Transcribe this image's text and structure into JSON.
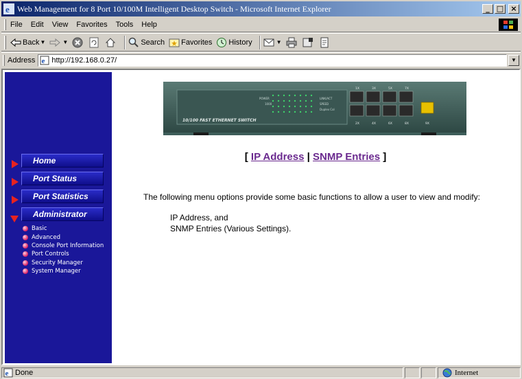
{
  "window": {
    "title": "Web Management for 8 Port 10/100M Intelligent Desktop Switch - Microsoft Internet Explorer",
    "minimize": "_",
    "maximize": "□",
    "close": "×"
  },
  "menubar": {
    "items": [
      {
        "label": "File"
      },
      {
        "label": "Edit"
      },
      {
        "label": "View"
      },
      {
        "label": "Favorites"
      },
      {
        "label": "Tools"
      },
      {
        "label": "Help"
      }
    ]
  },
  "toolbar": {
    "back": "Back",
    "search": "Search",
    "favorites": "Favorites",
    "history": "History"
  },
  "address": {
    "label": "Address",
    "url": "http://192.168.0.27/"
  },
  "sidebar": {
    "nav": [
      {
        "label": "Home",
        "expanded": false
      },
      {
        "label": "Port Status",
        "expanded": false
      },
      {
        "label": "Port Statistics",
        "expanded": false
      },
      {
        "label": "Administrator",
        "expanded": true
      }
    ],
    "sub_items": [
      {
        "label": "Basic"
      },
      {
        "label": "Advanced"
      },
      {
        "label": "Console Port Information"
      },
      {
        "label": "Port Controls"
      },
      {
        "label": "Security Manager"
      },
      {
        "label": "System Manager"
      }
    ]
  },
  "device": {
    "label": "10/100 FAST ETHERNET SWITCH",
    "indicators": [
      "POWER",
      "1000",
      "LINK/ACT",
      "SPEED",
      "Duplex Col"
    ],
    "port_labels_top": [
      "1X",
      "3X",
      "5X",
      "7X"
    ],
    "port_labels_bottom": [
      "2X",
      "4X",
      "6X",
      "8X",
      "9X"
    ]
  },
  "main": {
    "bracket_open": "[",
    "bracket_close": "]",
    "separator": "|",
    "link_ip": "IP Address",
    "link_snmp": "SNMP Entries",
    "description": "The following menu options provide some basic functions to allow a user to view and modify:",
    "options_line1": "IP Address, and",
    "options_line2": "SNMP Entries (Various Settings)."
  },
  "status": {
    "text": "Done",
    "zone": "Internet"
  },
  "colors": {
    "sidebar_bg": "#1a1799",
    "arrow": "#e8231f",
    "link": "#6b2a8f",
    "titlebar_start": "#0a246a",
    "titlebar_end": "#a6caf0"
  }
}
